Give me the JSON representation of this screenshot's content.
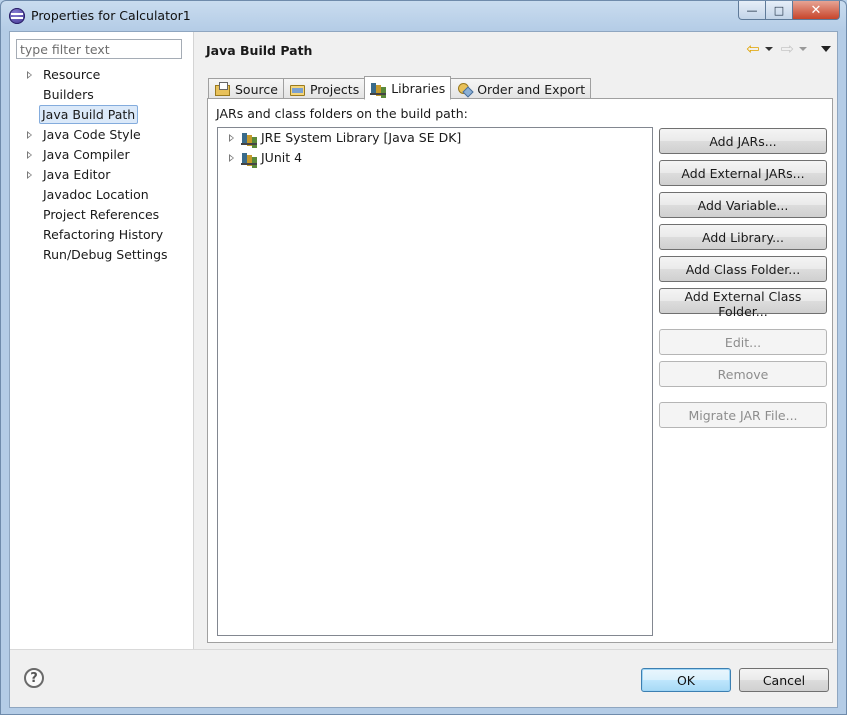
{
  "window": {
    "title": "Properties for Calculator1"
  },
  "filter": {
    "placeholder": "type filter text",
    "value": ""
  },
  "nav": {
    "items": [
      {
        "label": "Resource",
        "expandable": true
      },
      {
        "label": "Builders",
        "expandable": false
      },
      {
        "label": "Java Build Path",
        "expandable": false,
        "selected": true
      },
      {
        "label": "Java Code Style",
        "expandable": true
      },
      {
        "label": "Java Compiler",
        "expandable": true
      },
      {
        "label": "Java Editor",
        "expandable": true
      },
      {
        "label": "Javadoc Location",
        "expandable": false
      },
      {
        "label": "Project References",
        "expandable": false
      },
      {
        "label": "Refactoring History",
        "expandable": false
      },
      {
        "label": "Run/Debug Settings",
        "expandable": false
      }
    ]
  },
  "page": {
    "title": "Java Build Path"
  },
  "tabs": [
    {
      "label": "Source",
      "icon": "source-folder-icon"
    },
    {
      "label": "Projects",
      "icon": "projects-icon"
    },
    {
      "label": "Libraries",
      "icon": "libraries-icon",
      "active": true
    },
    {
      "label": "Order and Export",
      "icon": "order-export-icon"
    }
  ],
  "libraries": {
    "label": "JARs and class folders on the build path:",
    "entries": [
      {
        "label": "JRE System Library [Java SE DK]"
      },
      {
        "label": "JUnit 4"
      }
    ],
    "buttons": {
      "add_jars": "Add JARs...",
      "add_external_jars": "Add External JARs...",
      "add_variable": "Add Variable...",
      "add_library": "Add Library...",
      "add_class_folder": "Add Class Folder...",
      "add_external_class_folder": "Add External Class Folder...",
      "edit": "Edit...",
      "remove": "Remove",
      "migrate_jar": "Migrate JAR File..."
    }
  },
  "dialog": {
    "ok": "OK",
    "cancel": "Cancel"
  }
}
